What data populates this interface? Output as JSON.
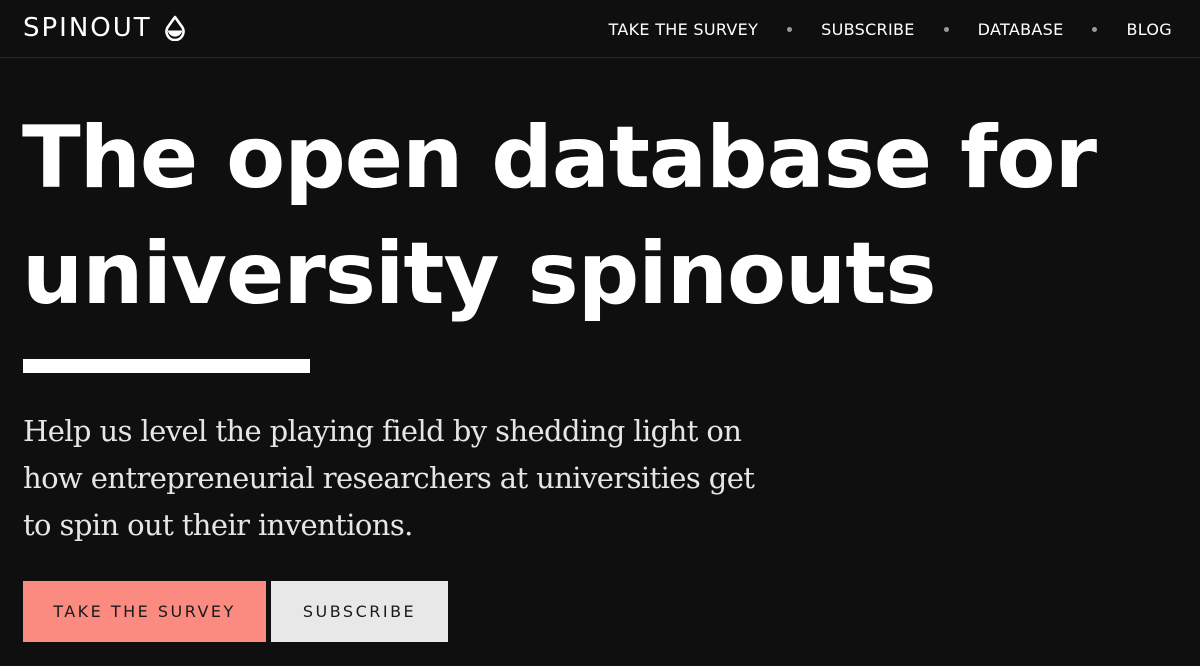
{
  "brand": {
    "name": "SPINOUT",
    "icon": "drop-icon"
  },
  "nav": {
    "items": [
      {
        "label": "TAKE THE SURVEY"
      },
      {
        "label": "SUBSCRIBE"
      },
      {
        "label": "DATABASE"
      },
      {
        "label": "BLOG"
      }
    ],
    "separator_icon": "dot-icon"
  },
  "hero": {
    "headline_lines": [
      "The open database for",
      "university spinouts"
    ],
    "lede_lines": [
      "Help us level the playing field by shedding light on",
      "how entrepreneurial researchers at universities get",
      "to spin out their inventions."
    ]
  },
  "cta": {
    "primary_label": "TAKE THE SURVEY",
    "secondary_label": "SUBSCRIBE"
  },
  "colors": {
    "background": "#0f0f10",
    "text": "#ffffff",
    "primary_button": "#fb8a80",
    "secondary_button": "#e8e8e8",
    "accent_rule": "#ffffff"
  }
}
